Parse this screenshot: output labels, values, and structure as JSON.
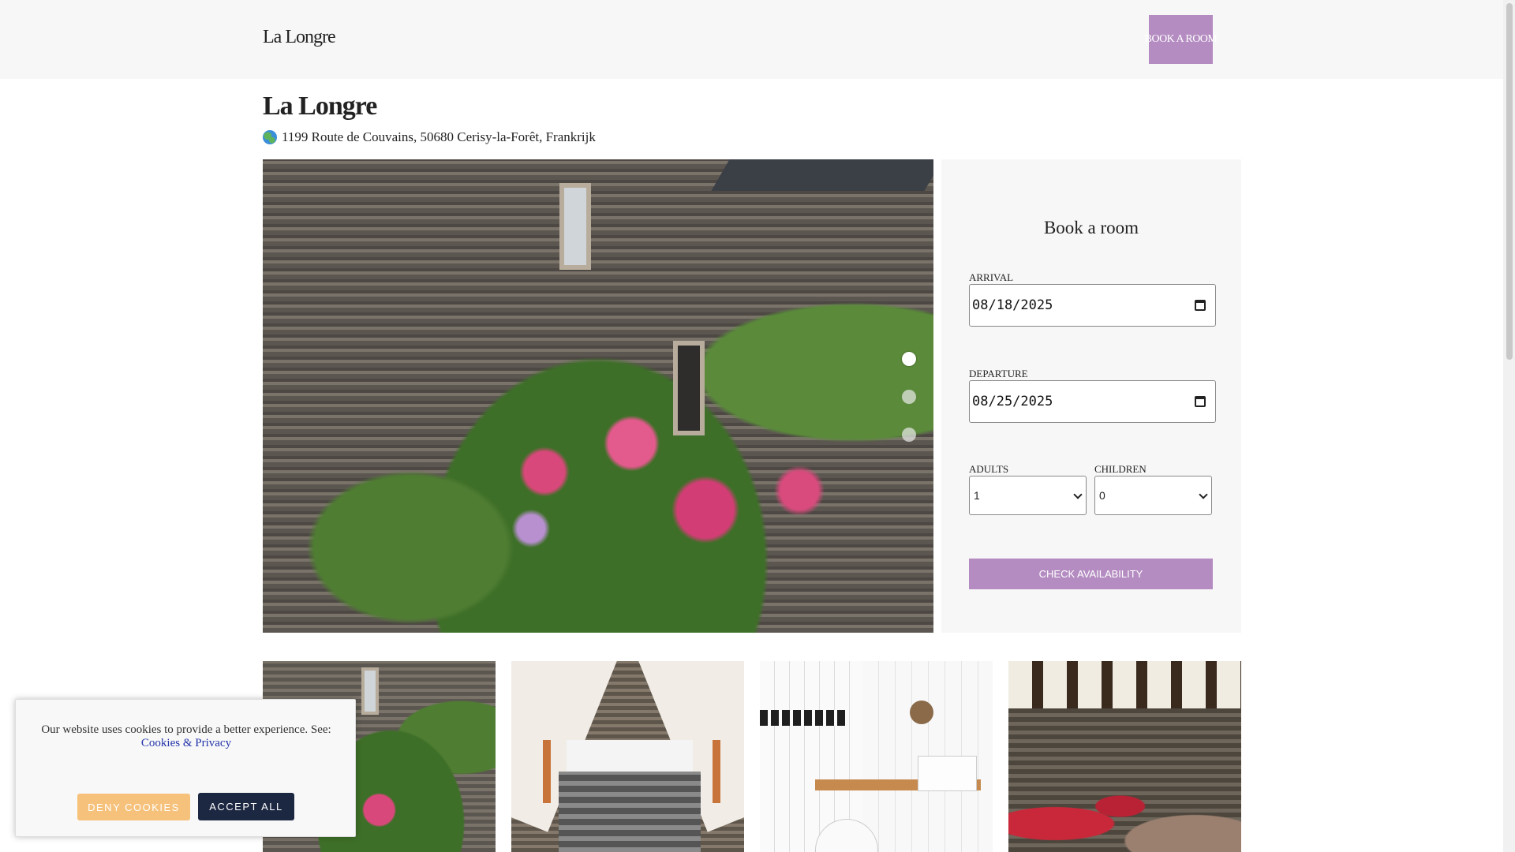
{
  "header": {
    "brand": "La Longre",
    "book_button": "BOOK A ROOM"
  },
  "property": {
    "title": "La Longre",
    "address": "1199 Route de Couvains, 50680 Cerisy-la-Forêt, Frankrijk",
    "address_icon": "globe-icon"
  },
  "gallery": {
    "slides": 3,
    "active_slide": 1,
    "thumbnails": [
      "exterior-hydrangeas",
      "bedroom",
      "bathroom",
      "restaurant"
    ]
  },
  "booking": {
    "title": "Book a room",
    "arrival_label": "ARRIVAL",
    "arrival_value": "08/18/2025",
    "departure_label": "DEPARTURE",
    "departure_value": "08/25/2025",
    "adults_label": "ADULTS",
    "adults_value": "1",
    "children_label": "CHILDREN",
    "children_value": "0",
    "check_button": "CHECK AVAILABILITY"
  },
  "cookie_banner": {
    "text": "Our website uses cookies to provide a better experience. See:",
    "link": "Cookies & Privacy",
    "deny_button": "DENY COOKIES",
    "accept_button": "ACCEPT ALL"
  },
  "colors": {
    "accent": "#b48cc1",
    "deny": "#f6c17b",
    "accept": "#1c2741",
    "panel_bg": "#f7f7f7"
  }
}
